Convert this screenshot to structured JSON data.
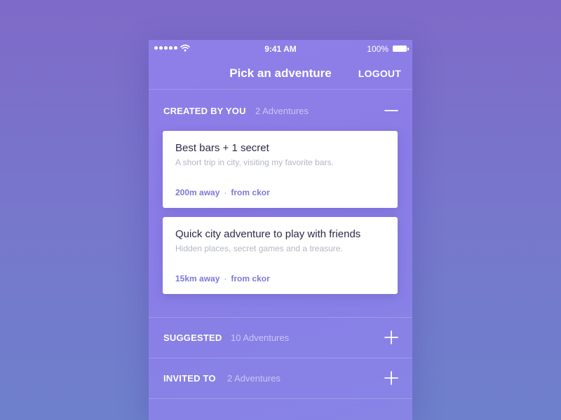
{
  "status_bar": {
    "time": "9:41 AM",
    "battery": "100%"
  },
  "nav": {
    "title": "Pick an adventure",
    "logout_label": "LOGOUT"
  },
  "sections": [
    {
      "label": "CREATED BY YOU",
      "count": "2 Adventures",
      "expanded": true,
      "cards": [
        {
          "title": "Best bars + 1 secret",
          "description": "A short trip in city, visiting my favorite bars.",
          "distance": "200m away",
          "author": "from ckor"
        },
        {
          "title": "Quick city adventure to play with friends",
          "description": "Hidden places, secret games and a treasure.",
          "distance": "15km away",
          "author": "from ckor"
        }
      ]
    },
    {
      "label": "SUGGESTED",
      "count": "10 Adventures",
      "expanded": false
    },
    {
      "label": "INVITED TO",
      "count": "2 Adventures",
      "expanded": false
    }
  ],
  "icons": {
    "collapse": "minus-icon",
    "expand": "plus-icon"
  },
  "colors": {
    "background": "#7e6ac8",
    "panel": "#8a7ce6",
    "accent": "#7b79d8",
    "card": "#ffffff"
  }
}
